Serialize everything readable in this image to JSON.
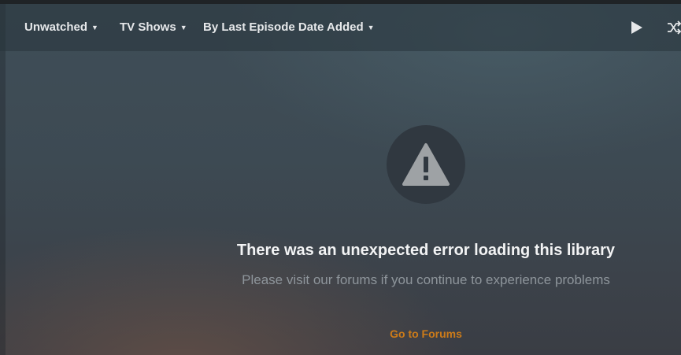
{
  "toolbar": {
    "filters": [
      {
        "label": "Unwatched"
      },
      {
        "label": "TV Shows"
      },
      {
        "label": "By Last Episode Date Added"
      }
    ],
    "play_icon": "play-icon",
    "shuffle_icon": "shuffle-icon"
  },
  "error": {
    "icon": "warning-icon",
    "title": "There was an unexpected error loading this library",
    "subtitle": "Please visit our forums if you continue to experience problems",
    "link_label": "Go to Forums"
  },
  "colors": {
    "accent": "#cc7b19",
    "title_text": "#f2f3f4",
    "subtitle_text": "#8e959b"
  }
}
